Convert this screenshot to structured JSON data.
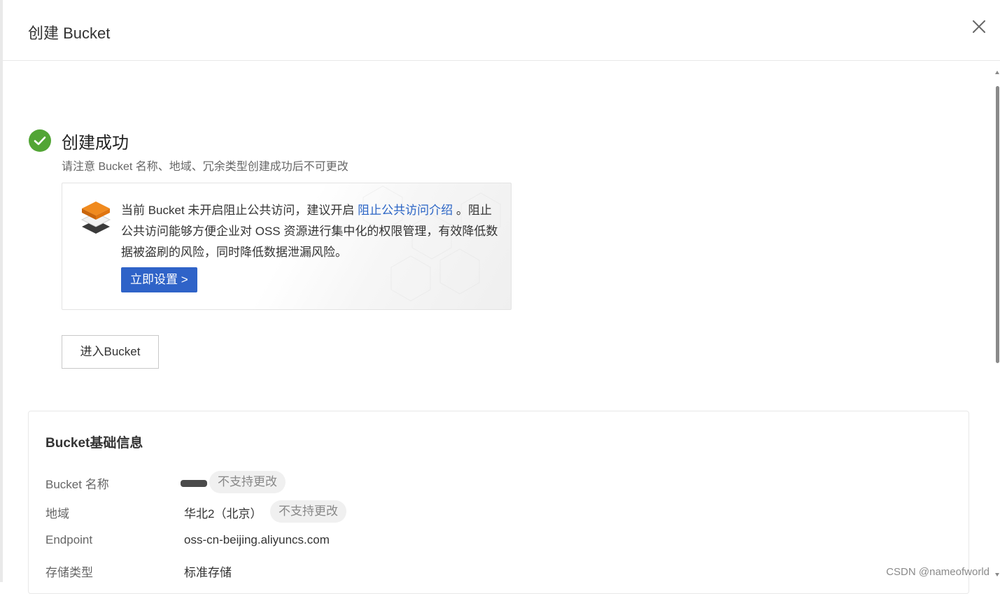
{
  "dialog": {
    "title": "创建 Bucket",
    "close_icon": "close-icon"
  },
  "success": {
    "icon": "check-circle-icon",
    "color": "#52a535",
    "title": "创建成功",
    "subtitle": "请注意 Bucket 名称、地域、冗余类型创建成功后不可更改"
  },
  "notice": {
    "icon": "layers-icon",
    "text_before_link": "当前 Bucket 未开启阻止公共访问，建议开启 ",
    "link": "阻止公共访问介绍",
    "text_after_link": " 。阻止公共访问能够方便企业对 OSS 资源进行集中化的权限管理，有效降低数据被盗刷的风险，同时降低数据泄漏风险。",
    "button": "立即设置 >"
  },
  "enter_button": "进入Bucket",
  "info": {
    "title": "Bucket基础信息",
    "rows": [
      {
        "label": "Bucket 名称",
        "value": "",
        "tag": "不支持更改"
      },
      {
        "label": "地域",
        "value": "华北2（北京）",
        "tag": "不支持更改"
      },
      {
        "label": "Endpoint",
        "value": "oss-cn-beijing.aliyuncs.com"
      },
      {
        "label": "存储类型",
        "value": "标准存储"
      }
    ]
  },
  "watermark": "CSDN @nameofworld",
  "colors": {
    "primary": "#2f63c8",
    "link": "#2a64c5",
    "success": "#52a535",
    "accent_orange": "#e8790f"
  }
}
